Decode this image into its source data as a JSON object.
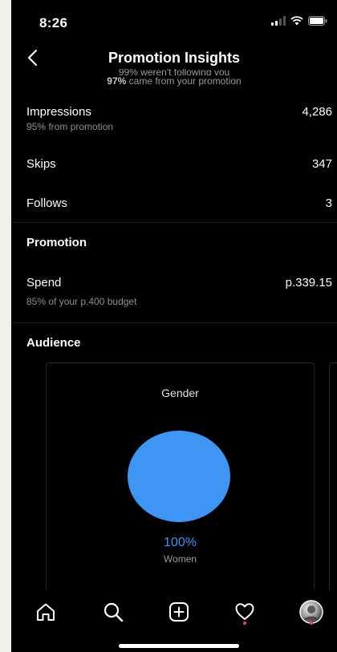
{
  "status_bar": {
    "time": "8:26"
  },
  "header": {
    "title": "Promotion Insights"
  },
  "banner": {
    "cut_line": "99% weren't following you",
    "pct": "97%",
    "rest": "came from your promotion"
  },
  "metrics": {
    "impressions": {
      "label": "Impressions",
      "sub": "95% from promotion",
      "value": "4,286"
    },
    "skips": {
      "label": "Skips",
      "value": "347"
    },
    "follows": {
      "label": "Follows",
      "value": "3"
    }
  },
  "promotion": {
    "title": "Promotion",
    "spend": {
      "label": "Spend",
      "sub": "85% of your p.400 budget",
      "value": "p.339.15"
    }
  },
  "audience": {
    "title": "Audience",
    "gender_card": {
      "title": "Gender",
      "percent": "100%",
      "label": "Women",
      "share_women": 1.0,
      "color": "#3e95f4"
    }
  },
  "tab_bar": {
    "items": [
      "home-icon",
      "search-icon",
      "create-icon",
      "activity-icon",
      "profile-avatar"
    ],
    "notification_color": "#ed4956"
  }
}
